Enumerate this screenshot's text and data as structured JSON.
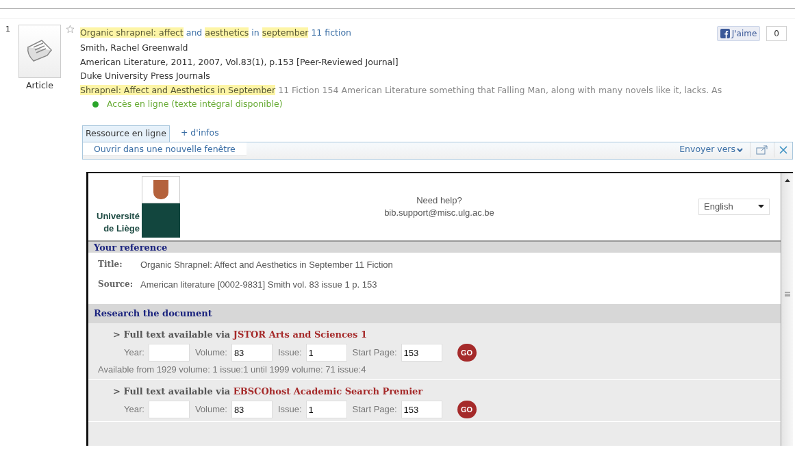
{
  "result": {
    "number": "1",
    "type_label": "Article",
    "favorite": false,
    "title": [
      {
        "text": "Organic shrapnel: affect",
        "highlighted": true
      },
      {
        "text": " and ",
        "highlighted": false
      },
      {
        "text": "aesthetics",
        "highlighted": true
      },
      {
        "text": " in ",
        "highlighted": false
      },
      {
        "text": "september",
        "highlighted": true
      },
      {
        "text": " 11 fiction",
        "highlighted": false
      }
    ],
    "author": "Smith, Rachel Greenwald",
    "citation": "American Literature, 2011, 2007, Vol.83(1), p.153 [Peer-Reviewed Journal]",
    "publisher": "Duke University Press Journals",
    "snippet": [
      {
        "text": "Shrapnel: Affect and Aesthetics in September",
        "highlighted": true
      },
      {
        "text": " 11 Fiction 154 American Literature something that Falling Man, along with many novels like it, lacks. As",
        "highlighted": false
      }
    ],
    "availability": {
      "text": "Accès en ligne (texte intégral disponible)",
      "color": "#2aa52a"
    },
    "like": {
      "label": "J'aime",
      "count": "0"
    }
  },
  "tabs": [
    {
      "label": "Ressource en ligne",
      "selected": true
    },
    {
      "label": "+ d'infos",
      "selected": false
    }
  ],
  "toolbar": {
    "open_new_window": "Ouvrir dans une nouvelle fenêtre",
    "send_to": "Envoyer vers"
  },
  "resolver": {
    "logo_line1": "Université",
    "logo_line2": "de Liège",
    "help": "Need help?",
    "email": "bib.support@misc.ulg.ac.be",
    "language": "English",
    "reference_heading": "Your reference",
    "reference": [
      {
        "label": "Title:",
        "value": "Organic Shrapnel: Affect and Aesthetics in September 11 Fiction"
      },
      {
        "label": "Source:",
        "value": "American literature [0002-9831] Smith vol. 83 issue 1 p. 153"
      }
    ],
    "research_heading": "Research the document",
    "sources": [
      {
        "prefix": "> Full text available via ",
        "name": "JSTOR Arts and Sciences 1",
        "fields": [
          {
            "label": "Year:"
          },
          {
            "label": "Volume:",
            "value": "83"
          },
          {
            "label": "Issue:",
            "value": "1"
          },
          {
            "label": "Start Page:",
            "value": "153"
          }
        ],
        "go": "GO",
        "coverage": "Available from 1929 volume: 1 issue:1 until 1999 volume: 71 issue:4"
      },
      {
        "prefix": "> Full text available via ",
        "name": "EBSCOhost Academic Search Premier",
        "fields": [
          {
            "label": "Year:"
          },
          {
            "label": "Volume:",
            "value": "83"
          },
          {
            "label": "Issue:",
            "value": "1"
          },
          {
            "label": "Start Page:",
            "value": "153"
          }
        ],
        "go": "GO"
      }
    ]
  }
}
